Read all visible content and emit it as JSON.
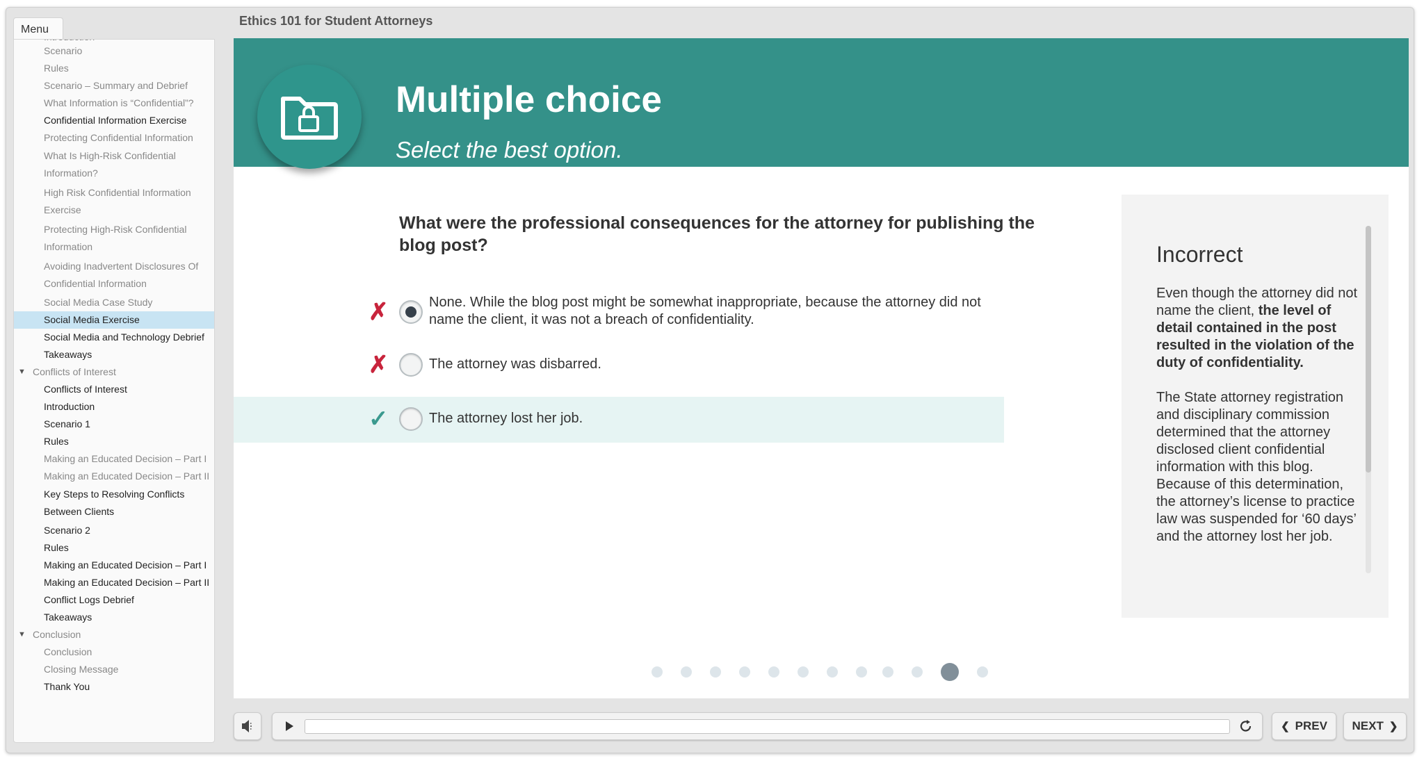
{
  "course_title": "Ethics 101 for Student Attorneys",
  "menu": {
    "tab_label": "Menu",
    "items": [
      {
        "label": "Introduction",
        "style": "cut"
      },
      {
        "label": "Scenario",
        "style": "muted"
      },
      {
        "label": "Rules",
        "style": "muted"
      },
      {
        "label": "Scenario – Summary and Debrief",
        "style": "muted"
      },
      {
        "label": "What Information is “Confidential”?",
        "style": "muted"
      },
      {
        "label": "Confidential Information Exercise",
        "style": "dark"
      },
      {
        "label": "Protecting Confidential Information",
        "style": "muted"
      },
      {
        "label": "What Is High-Risk Confidential Information?",
        "style": "muted",
        "wrap": true
      },
      {
        "label": "High Risk Confidential Information Exercise",
        "style": "muted",
        "wrap": true
      },
      {
        "label": "Protecting High-Risk Confidential Information",
        "style": "muted",
        "wrap": true
      },
      {
        "label": "Avoiding Inadvertent Disclosures Of Confidential Information",
        "style": "muted",
        "wrap": true
      },
      {
        "label": "Social Media Case Study",
        "style": "muted"
      },
      {
        "label": "Social Media Exercise",
        "style": "active"
      },
      {
        "label": "Social Media and Technology Debrief",
        "style": "dark"
      },
      {
        "label": "Takeaways",
        "style": "dark"
      },
      {
        "label": "Conflicts of Interest",
        "style": "section"
      },
      {
        "label": "Conflicts of Interest",
        "style": "dark"
      },
      {
        "label": "Introduction",
        "style": "dark"
      },
      {
        "label": "Scenario 1",
        "style": "dark"
      },
      {
        "label": "Rules",
        "style": "dark"
      },
      {
        "label": "Making an Educated Decision – Part I",
        "style": "muted"
      },
      {
        "label": "Making an Educated Decision – Part II",
        "style": "muted"
      },
      {
        "label": "Key Steps to Resolving Conflicts Between Clients",
        "style": "dark",
        "wrap": true
      },
      {
        "label": "Scenario 2",
        "style": "dark"
      },
      {
        "label": "Rules",
        "style": "dark"
      },
      {
        "label": "Making an Educated Decision – Part I",
        "style": "dark"
      },
      {
        "label": "Making an Educated Decision – Part II",
        "style": "dark"
      },
      {
        "label": "Conflict Logs Debrief",
        "style": "dark"
      },
      {
        "label": "Takeaways",
        "style": "dark"
      },
      {
        "label": "Conclusion",
        "style": "section"
      },
      {
        "label": "Conclusion",
        "style": "muted"
      },
      {
        "label": "Closing Message",
        "style": "muted"
      },
      {
        "label": "Thank You",
        "style": "dark"
      }
    ]
  },
  "slide": {
    "title": "Multiple choice",
    "subtitle": "Select the best option.",
    "icon": "lock-folder-icon",
    "question": "What were the professional consequences for the attorney for publishing the blog post?",
    "options": [
      {
        "text": "None. While the blog post might be somewhat inappropriate, because the attorney did not name the client, it was not a breach of confidentiality.",
        "selected": true,
        "result": "incorrect"
      },
      {
        "text": "The attorney was disbarred.",
        "selected": false,
        "result": "incorrect"
      },
      {
        "text": "The attorney lost her job.",
        "selected": false,
        "result": "correct"
      }
    ],
    "feedback": {
      "title": "Incorrect",
      "para1_prefix": "Even though the attorney did not name the client, ",
      "para1_bold": "the level of detail contained in the post resulted in the violation of the duty of confidentiality.",
      "para2": "The State attorney registration and disciplinary commission determined that the attorney disclosed client confidential information with this blog. Because of this determination, the attorney’s license to practice law was suspended for ‘60 days’ and the attorney lost her job."
    },
    "pagination": {
      "total": 12,
      "current": 11
    }
  },
  "player": {
    "prev_label": "PREV",
    "next_label": "NEXT",
    "progress": 0
  },
  "colors": {
    "banner": "#349189",
    "incorrect": "#c8243c",
    "correct": "#3b9a8f",
    "menu_active": "#c8e4f3"
  }
}
